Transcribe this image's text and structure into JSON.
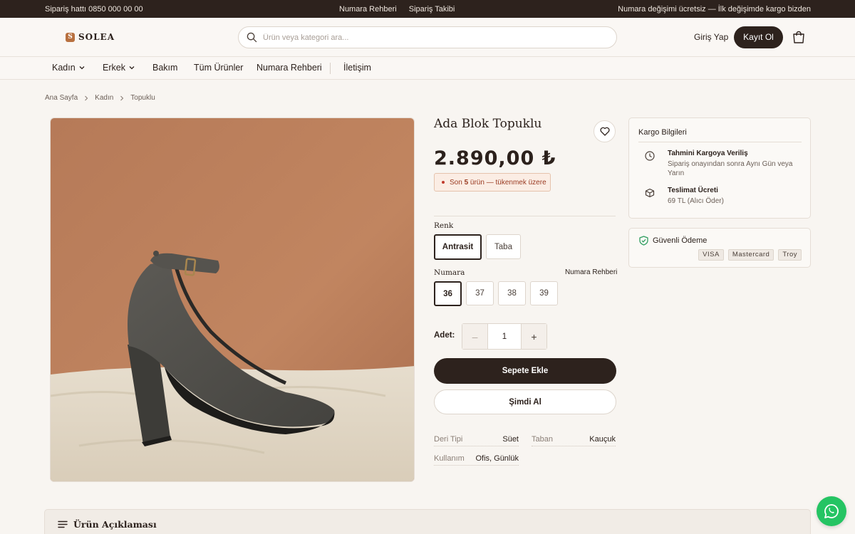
{
  "topbar": {
    "phone": "Sipariş hattı 0850 000 00 00",
    "links": [
      "Numara Rehberi",
      "Sipariş Takibi"
    ],
    "promo": "Numara değişimi ücretsiz — İlk değişimde kargo bizden"
  },
  "header": {
    "logo_letter": "S",
    "logo_text": "SOLEA",
    "search_placeholder": "Ürün veya kategori ara...",
    "login_label": "Giriş Yap",
    "register_label": "Kayıt Ol"
  },
  "nav": {
    "items": [
      "Kadın",
      "Erkek",
      "Bakım",
      "Tüm Ürünler",
      "Numara Rehberi",
      "İletişim"
    ]
  },
  "breadcrumb": [
    "Ana Sayfa",
    "Kadın",
    "Topuklu"
  ],
  "product": {
    "title": "Ada Blok Topuklu",
    "price": "2.890,00 ₺",
    "stock_prefix": "Son ",
    "stock_count": "5",
    "stock_suffix": " ürün — tükenmek üzere",
    "color_label": "Renk",
    "colors": [
      "Antrasit",
      "Taba"
    ],
    "selected_color": "Antrasit",
    "size_label": "Numara",
    "size_guide": "Numara Rehberi",
    "sizes": [
      "36",
      "37",
      "38",
      "39"
    ],
    "selected_size": "36",
    "qty_label": "Adet:",
    "qty_minus": "–",
    "qty_value": "1",
    "qty_plus": "+",
    "add_to_cart": "Sepete Ekle",
    "buy_now": "Şimdi Al",
    "specs": [
      {
        "key": "Deri Tipi",
        "value": "Süet"
      },
      {
        "key": "Taban",
        "value": "Kauçuk"
      },
      {
        "key": "Kullanım",
        "value": "Ofis, Günlük"
      }
    ]
  },
  "shipping": {
    "title": "Kargo Bilgileri",
    "rows": [
      {
        "heading": "Tahmini Kargoya Veriliş",
        "detail": "Sipariş onayından sonra Aynı Gün veya Yarın"
      },
      {
        "heading": "Teslimat Ücreti",
        "detail": "69 TL (Alıcı Öder)"
      }
    ]
  },
  "payment": {
    "title": "Güvenli Ödeme",
    "badges": [
      "VISA",
      "Mastercard",
      "Troy"
    ]
  },
  "description": {
    "title": "Ürün Açıklaması"
  },
  "colors": {
    "dark": "#2d221d",
    "accent": "#b8703f",
    "background": "#f8f5f1",
    "stock_warning": "#9a3b22",
    "whatsapp": "#25c463",
    "secure_green": "#2e9d5f"
  },
  "icons": [
    "search-icon",
    "cart-icon",
    "chevron-down-icon",
    "chevron-right-icon",
    "heart-icon",
    "clock-icon",
    "box-icon",
    "shield-check-icon",
    "menu-lines-icon",
    "whatsapp-icon"
  ]
}
